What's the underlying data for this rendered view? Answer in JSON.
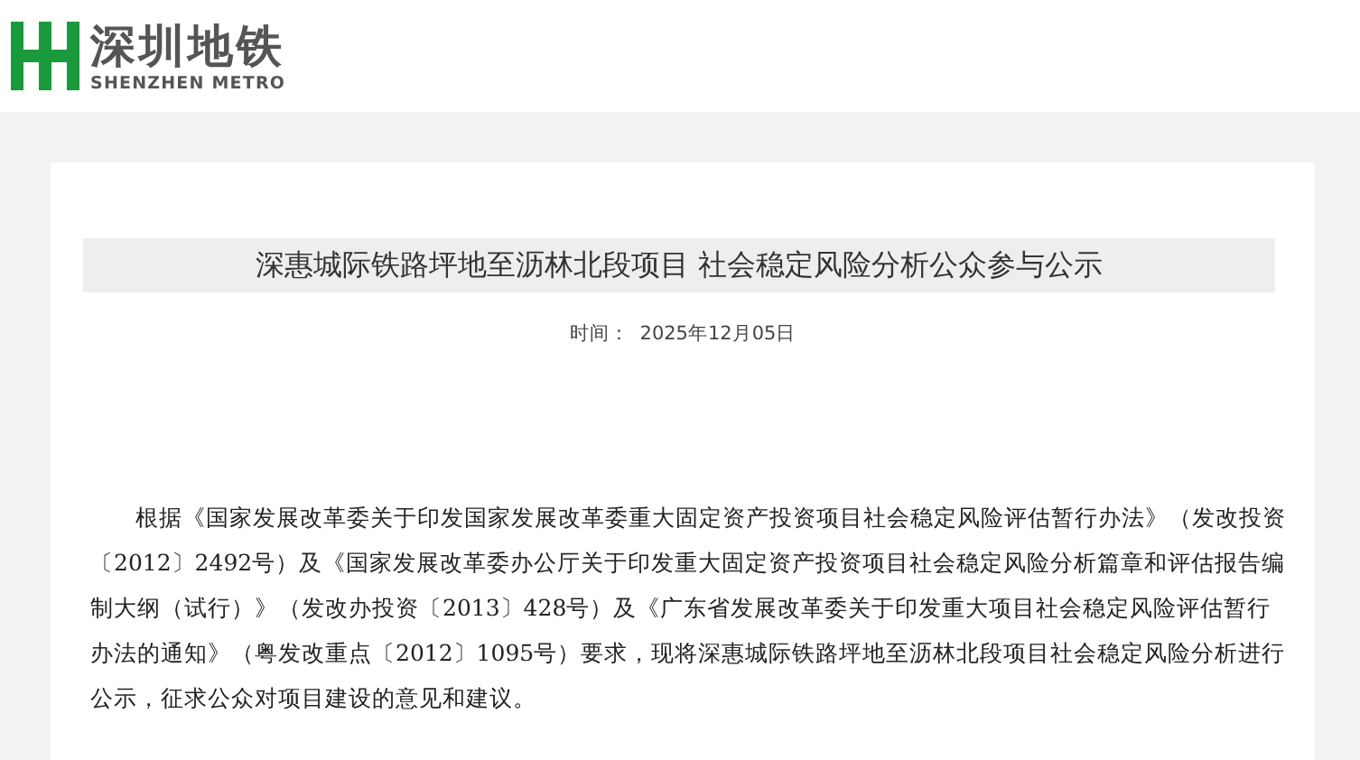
{
  "logo": {
    "name": "深圳地铁",
    "subtitle": "SHENZHEN METRO"
  },
  "article": {
    "title": "深惠城际铁路坪地至沥林北段项目 社会稳定风险分析公众参与公示",
    "time_label": "时间：",
    "date": "2025年12月05日",
    "body": "根据《国家发展改革委关于印发国家发展改革委重大固定资产投资项目社会稳定风险评估暂行办法》（发改投资〔2012〕2492号）及《国家发展改革委办公厅关于印发重大固定资产投资项目社会稳定风险分析篇章和评估报告编制大纲（试行）》（发改办投资〔2013〕428号）及《广东省发展改革委关于印发重大项目社会稳定风险评估暂行办法的通知》（粤发改重点〔2012〕1095号）要求，现将深惠城际铁路坪地至沥林北段项目社会稳定风险分析进行公示，征求公众对项目建设的意见和建议。"
  }
}
